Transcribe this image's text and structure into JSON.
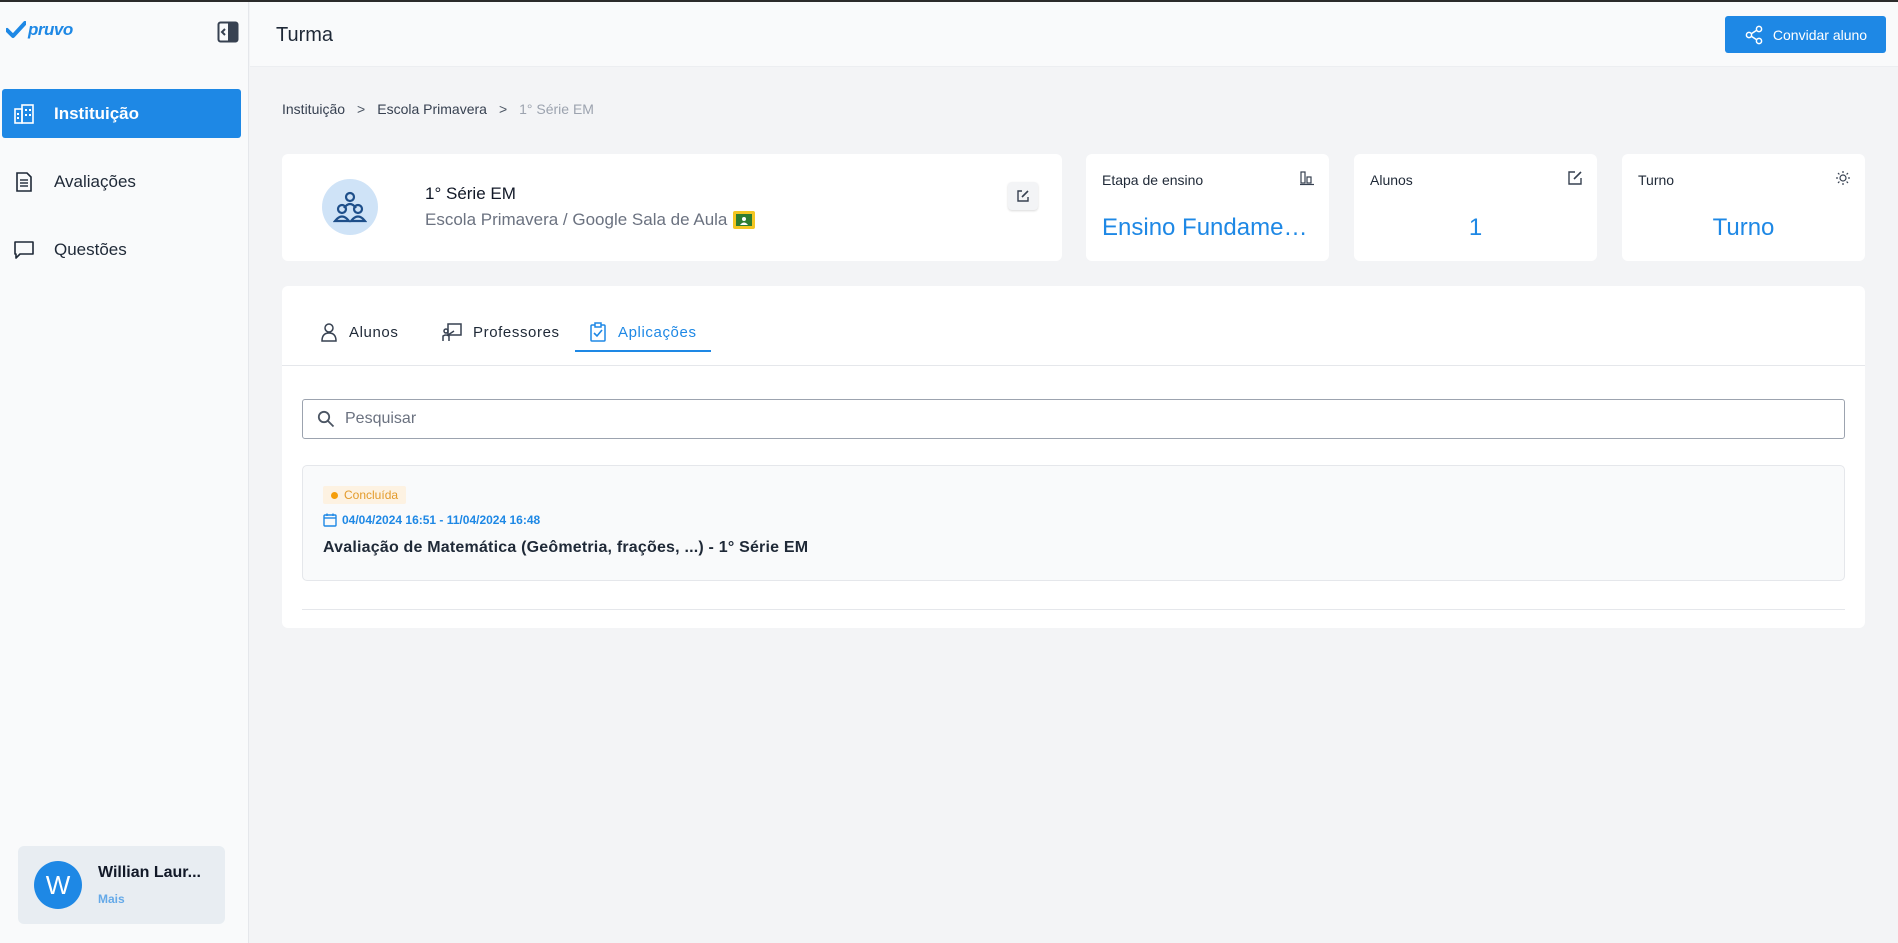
{
  "brand": {
    "logo_text": "pruvo",
    "accent": "#1e88e5"
  },
  "sidebar": {
    "items": [
      {
        "label": "Instituição",
        "icon": "building-icon",
        "active": true
      },
      {
        "label": "Avaliações",
        "icon": "document-icon",
        "active": false
      },
      {
        "label": "Questões",
        "icon": "comment-icon",
        "active": false
      }
    ],
    "user": {
      "initial": "W",
      "name": "Willian Laur...",
      "more": "Mais"
    }
  },
  "header": {
    "title": "Turma",
    "invite_label": "Convidar aluno"
  },
  "breadcrumb": {
    "items": [
      "Instituição",
      "Escola Primavera",
      "1° Série EM"
    ],
    "separator": ">"
  },
  "class_card": {
    "name": "1° Série EM",
    "subtitle": "Escola Primavera / Google Sala de Aula"
  },
  "stats": [
    {
      "label": "Etapa de ensino",
      "value": "Ensino Fundamental",
      "icon": "chart-icon"
    },
    {
      "label": "Alunos",
      "value": "1",
      "icon": "edit-square-icon"
    },
    {
      "label": "Turno",
      "value": "Turno",
      "icon": "sun-icon"
    }
  ],
  "tabs": [
    {
      "label": "Alunos",
      "icon": "person-icon",
      "active": false
    },
    {
      "label": "Professores",
      "icon": "teacher-icon",
      "active": false
    },
    {
      "label": "Aplicações",
      "icon": "clipboard-check-icon",
      "active": true
    }
  ],
  "search": {
    "placeholder": "Pesquisar",
    "value": ""
  },
  "applications": [
    {
      "status": "Concluída",
      "dates": "04/04/2024 16:51 - 11/04/2024 16:48",
      "title": "Avaliação de Matemática (Geômetria, frações, ...) - 1° Série EM"
    }
  ]
}
